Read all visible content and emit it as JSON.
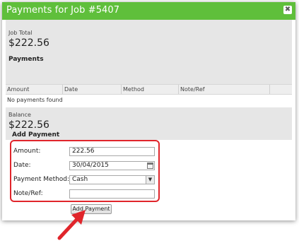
{
  "dialog": {
    "title": "Payments for Job #5407",
    "close_glyph": "✖"
  },
  "job_total": {
    "label": "Job Total",
    "value": "$222.56"
  },
  "payments": {
    "heading": "Payments",
    "columns": [
      "Amount",
      "Date",
      "Method",
      "Note/Ref"
    ],
    "empty_text": "No payments found"
  },
  "balance": {
    "label": "Balance",
    "value": "$222.56"
  },
  "add_payment": {
    "heading": "Add Payment",
    "amount_label": "Amount:",
    "amount_value": "222.56",
    "date_label": "Date:",
    "date_value": "30/04/2015",
    "method_label": "Payment Method:",
    "method_value": "Cash",
    "note_label": "Note/Ref:",
    "note_value": "",
    "button_label": "Add Payment"
  },
  "colors": {
    "title_bar": "#5fbf3b",
    "highlight": "#e0252b"
  },
  "icons": [
    "close-icon",
    "calendar-icon",
    "chevron-down-icon",
    "arrow-annotation"
  ]
}
